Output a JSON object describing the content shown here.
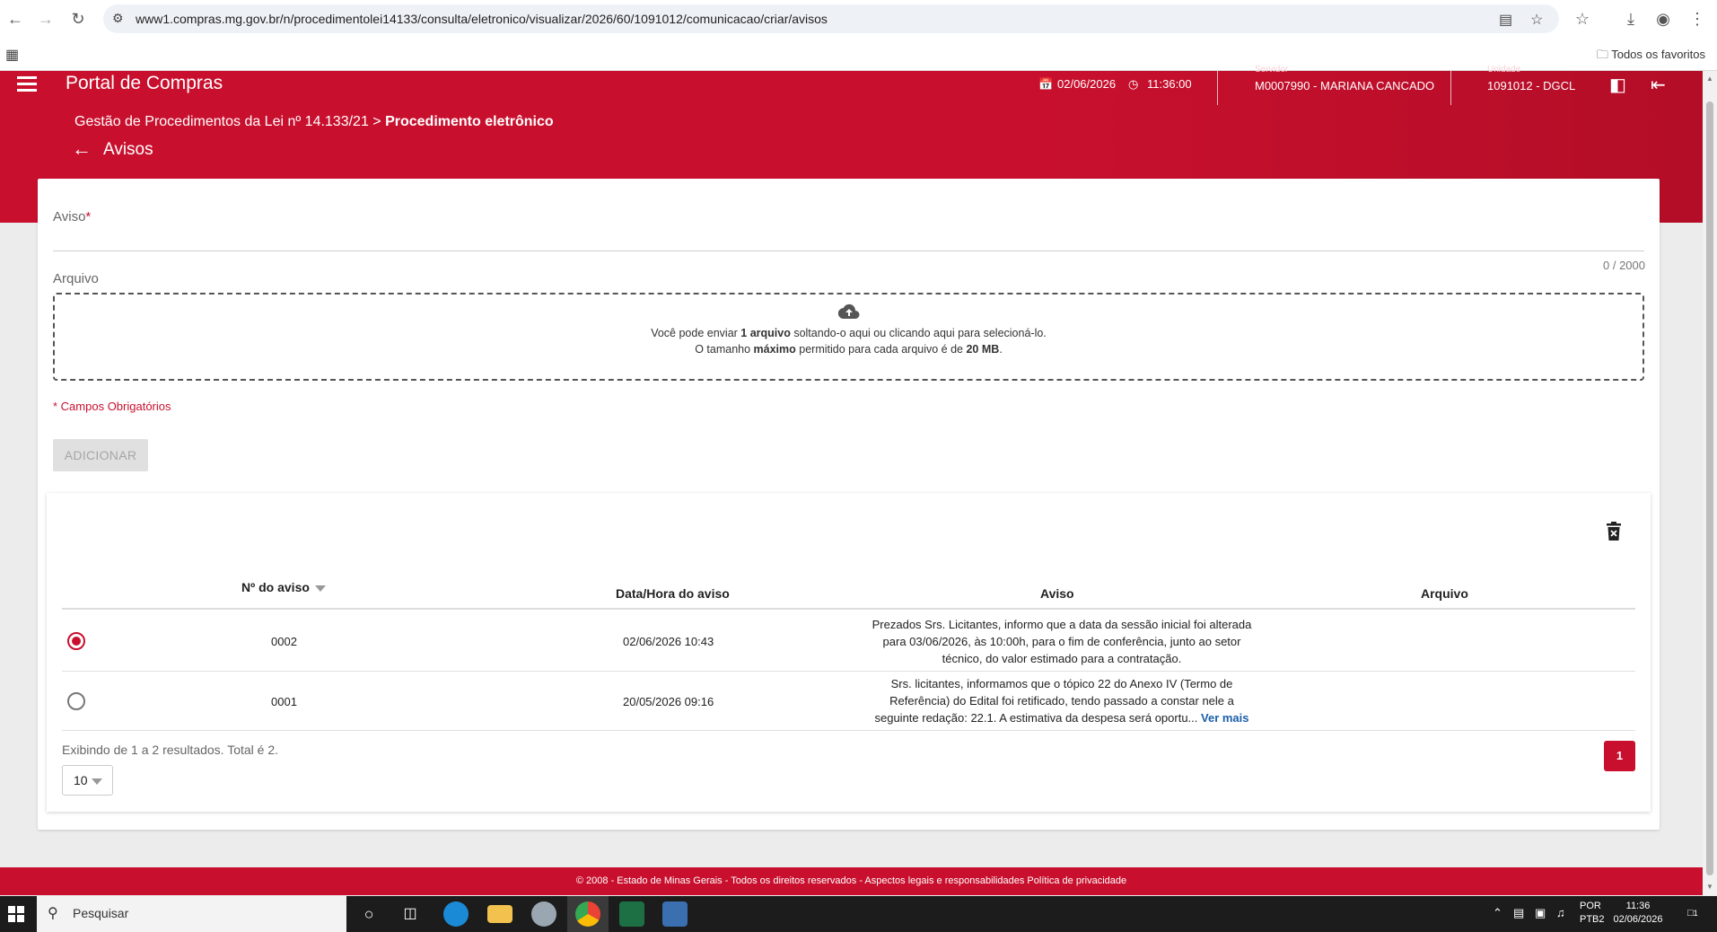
{
  "browser": {
    "url": "www1.compras.mg.gov.br/n/procedimentolei14133/consulta/eletronico/visualizar/2026/60/1091012/comunicacao/criar/avisos",
    "bookmarks_label": "Todos os favoritos"
  },
  "header": {
    "portal_title": "Portal de Compras",
    "date": "02/06/2026",
    "time": "11:36:00",
    "servidor_label": "Servidor",
    "servidor_value": "M0007990 - MARIANA CANCADO",
    "unidade_label": "Unidade",
    "unidade_value": "1091012 - DGCL",
    "breadcrumb_root": "Gestão de Procedimentos da Lei nº 14.133/21",
    "breadcrumb_sep": " > ",
    "breadcrumb_current": "Procedimento eletrônico",
    "page_title": "Avisos"
  },
  "form": {
    "aviso_label": "Aviso",
    "required_mark": "*",
    "counter": "0 / 2000",
    "arquivo_label": "Arquivo",
    "drop_line1_pre": "Você pode enviar ",
    "drop_line1_bold": "1 arquivo",
    "drop_line1_post": " soltando-o aqui ou clicando aqui para selecioná-lo.",
    "drop_line2_pre": "O tamanho ",
    "drop_line2_bold": "máximo",
    "drop_line2_mid": " permitido para cada arquivo é de ",
    "drop_line2_bold2": "20 MB",
    "drop_line2_post": ".",
    "mandatory_note": "* Campos Obrigatórios",
    "add_button": "ADICIONAR"
  },
  "table": {
    "columns": [
      "Nº do aviso",
      "Data/Hora do aviso",
      "Aviso",
      "Arquivo"
    ],
    "rows": [
      {
        "selected": true,
        "numero": "0002",
        "data_hora": "02/06/2026 10:43",
        "aviso": "Prezados Srs. Licitantes, informo que a data da sessão inicial foi alterada para 03/06/2026, às 10:00h, para o fim de conferência, junto ao setor técnico, do valor estimado para a contratação.",
        "arquivo": ""
      },
      {
        "selected": false,
        "numero": "0001",
        "data_hora": "20/05/2026 09:16",
        "aviso": "Srs. licitantes, informamos que o tópico 22 do Anexo IV (Termo de Referência) do Edital foi retificado, tendo passado a constar nele a seguinte redação: 22.1. A estimativa da despesa será oportu...",
        "ver_mais": "Ver mais",
        "arquivo": ""
      }
    ],
    "results_text": "Exibindo de 1 a 2 resultados. Total é 2.",
    "page_size": "10",
    "current_page": "1"
  },
  "footer": {
    "text": "© 2008 - Estado de Minas Gerais - Todos os direitos reservados - Aspectos legais e responsabilidades Política de privacidade"
  },
  "taskbar": {
    "search_placeholder": "Pesquisar",
    "lang": "POR",
    "layout": "PTB2",
    "time": "11:36",
    "date": "02/06/2026",
    "notifications": "1"
  },
  "colors": {
    "brand_red": "#c8102e",
    "link_blue": "#1a5fa8"
  }
}
